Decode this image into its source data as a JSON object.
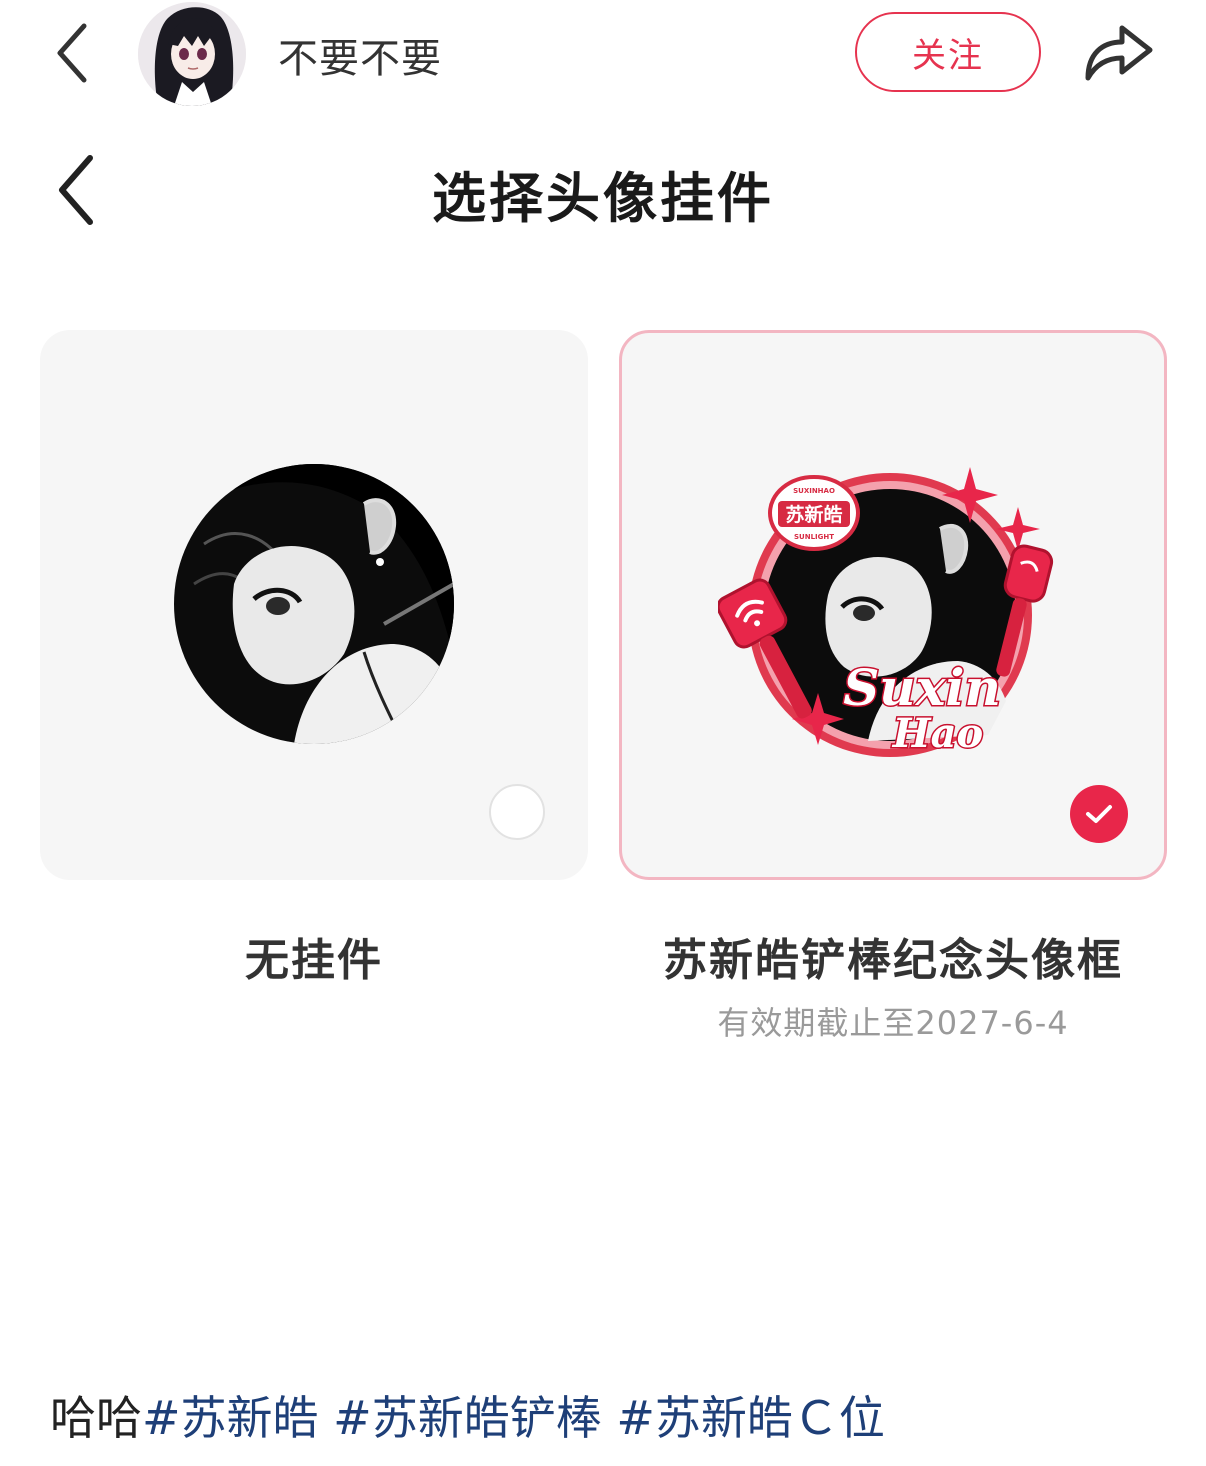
{
  "header": {
    "author_name": "不要不要",
    "follow_label": "关注",
    "back_icon": "chevron-left-icon",
    "share_icon": "share-arrow-icon"
  },
  "screenshot": {
    "title": "选择头像挂件",
    "options": [
      {
        "label": "无挂件",
        "selected": false
      },
      {
        "label": "苏新皓铲棒纪念头像框",
        "expiry": "有效期截止至2027-6-4",
        "selected": true
      }
    ],
    "frame_badge_top": "苏新皓",
    "frame_badge_top_small_upper": "SUXINHAO",
    "frame_badge_top_small_lower": "SUNLIGHT",
    "frame_script_line1": "Suxin",
    "frame_script_line2": "Hao"
  },
  "caption": {
    "prefix": "哈哈",
    "tags": [
      "#苏新皓",
      " #苏新皓铲棒",
      " #苏新皓Ｃ位"
    ]
  },
  "colors": {
    "accent": "#e6334f",
    "check": "#e8264a",
    "selected_border": "#f3b6c2",
    "card_bg": "#f6f6f6",
    "hashtag": "#1e3f78"
  }
}
